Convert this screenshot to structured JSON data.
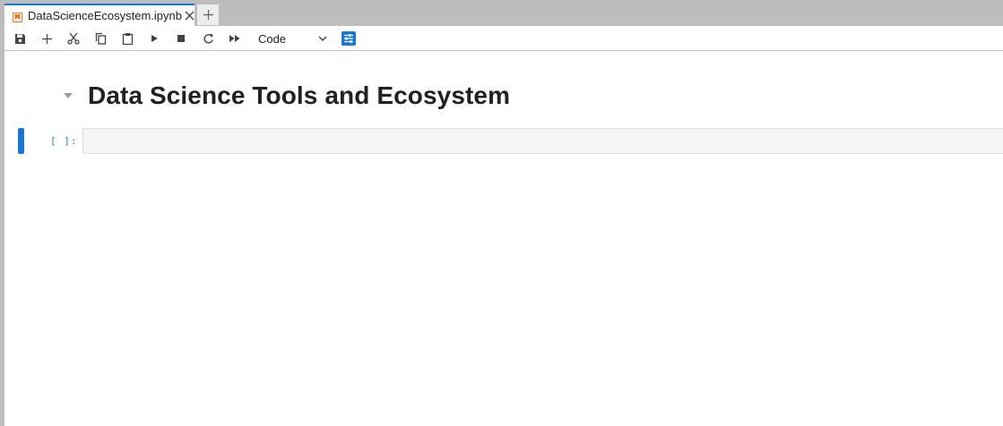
{
  "tab": {
    "title": "DataScienceEcosystem.ipynb",
    "icon": "notebook-icon",
    "close_icon": "close-icon",
    "add_icon": "plus-icon"
  },
  "toolbar": {
    "buttons": [
      {
        "name": "save-button",
        "icon": "save-icon"
      },
      {
        "name": "insert-cell-button",
        "icon": "plus-icon"
      },
      {
        "name": "cut-button",
        "icon": "scissors-icon"
      },
      {
        "name": "copy-button",
        "icon": "copy-icon"
      },
      {
        "name": "paste-button",
        "icon": "clipboard-icon"
      },
      {
        "name": "run-button",
        "icon": "play-icon"
      },
      {
        "name": "stop-button",
        "icon": "stop-icon"
      },
      {
        "name": "restart-button",
        "icon": "restart-icon"
      },
      {
        "name": "run-all-button",
        "icon": "fast-forward-icon"
      }
    ],
    "cell_type": "Code",
    "property_inspector_icon": "sliders-icon"
  },
  "notebook": {
    "heading": "Data Science Tools and Ecosystem",
    "code_cell": {
      "prompt": "[ ]:",
      "content": ""
    }
  },
  "colors": {
    "accent": "#1976d2",
    "tabbar": "#bdbdbd",
    "notebook_icon": "#f37726",
    "prompt": "#307fc1"
  }
}
